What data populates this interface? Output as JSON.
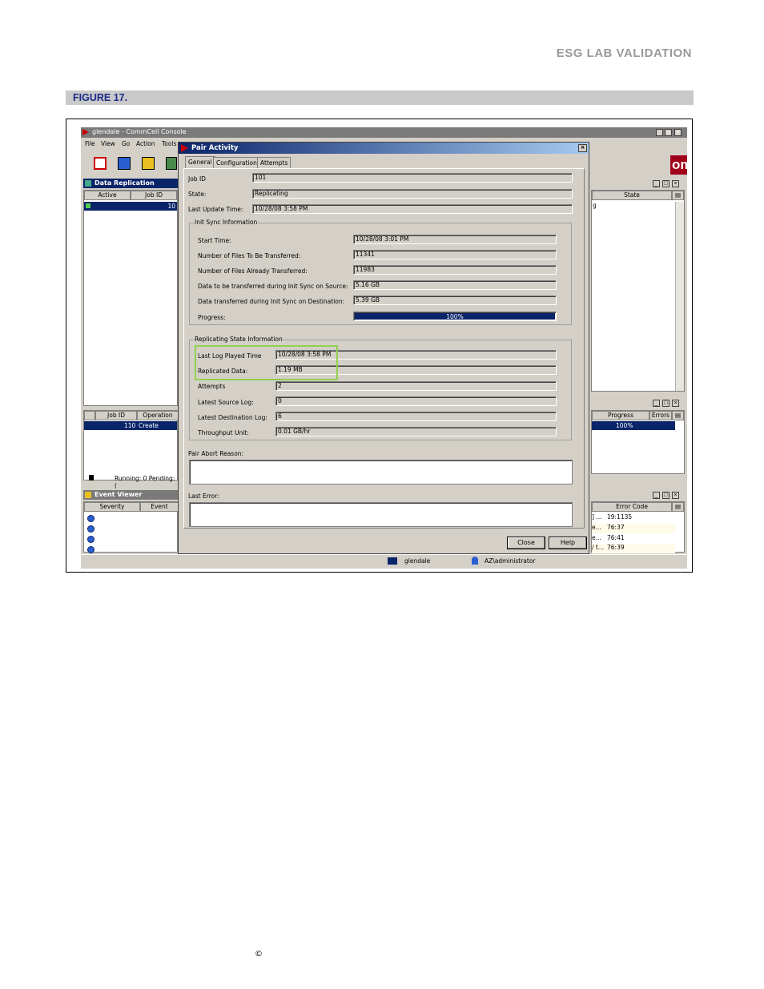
{
  "page": {
    "header": "ESG LAB VALIDATION",
    "figure_label": "FIGURE 17.",
    "copyright_symbol": "©"
  },
  "console": {
    "title": "glendale - CommCell Console",
    "menu": [
      "File",
      "View",
      "Go",
      "Action",
      "Tools"
    ],
    "brand": "ommvault",
    "replication_monitor": {
      "title": "Data Replication Monitor",
      "columns": [
        "Active",
        "Job ID"
      ],
      "row_value": "10",
      "right_column": "State",
      "right_value": "g"
    },
    "jobs_panel": {
      "columns": [
        "Job ID",
        "Operation"
      ],
      "row": {
        "job_id": "110",
        "operation": "Create Conso"
      },
      "right_columns": [
        "Progress",
        "Errors"
      ],
      "right_progress": "100%",
      "status": "Running: 0 Pending: ("
    },
    "event_viewer": {
      "title": "Event Viewer (Informatio",
      "columns": [
        "Severity",
        "Event"
      ],
      "right_column": "Error Code",
      "rows": [
        {
          "prefix": "] ...",
          "code": "19:1135"
        },
        {
          "prefix": "e...",
          "code": "76:37"
        },
        {
          "prefix": "e...",
          "code": "76:41"
        },
        {
          "prefix": "/ t...",
          "code": "76:39"
        }
      ]
    },
    "statusbar": {
      "host": "glendale",
      "user": "AZ\\administrator"
    }
  },
  "dialog": {
    "title": "Pair Activity",
    "tabs": [
      "General",
      "Configuration",
      "Attempts"
    ],
    "fields": {
      "job_id_label": "Job ID",
      "job_id": "101",
      "state_label": "State:",
      "state": "Replicating",
      "last_update_label": "Last Update Time:",
      "last_update": "10/28/08 3:58 PM"
    },
    "init_sync": {
      "title": "Init Sync Information",
      "start_time_label": "Start Time:",
      "start_time": "10/28/08 3:01 PM",
      "files_to_transfer_label": "Number of Files To Be Transferred:",
      "files_to_transfer": "11341",
      "files_transferred_label": "Number of Files Already Transferred:",
      "files_transferred": "11983",
      "data_source_label": "Data to be transferred during Init Sync on Source:",
      "data_source": "5.16 GB",
      "data_dest_label": "Data transferred during Init Sync on Destination:",
      "data_dest": "5.39 GB",
      "progress_label": "Progress:",
      "progress": "100%"
    },
    "replicating": {
      "title": "Replicating State Information",
      "last_log_label": "Last Log Played Time",
      "last_log": "10/28/08 3:58 PM",
      "replicated_label": "Replicated Data:",
      "replicated": "1.19 MB",
      "attempts_label": "Attempts",
      "attempts": "2",
      "latest_source_label": "Latest Source Log:",
      "latest_source": "0",
      "latest_dest_label": "Latest Destination Log:",
      "latest_dest": "6",
      "throughput_label": "Throughput Unit:",
      "throughput": "0.01 GB/hr"
    },
    "abort_label": "Pair Abort Reason:",
    "error_label": "Last Error:",
    "close_button": "Close",
    "help_button": "Help"
  },
  "colors": {
    "highlight_box": "#8fd14f",
    "selection": "#0a246a",
    "brand": "#a0001a"
  }
}
